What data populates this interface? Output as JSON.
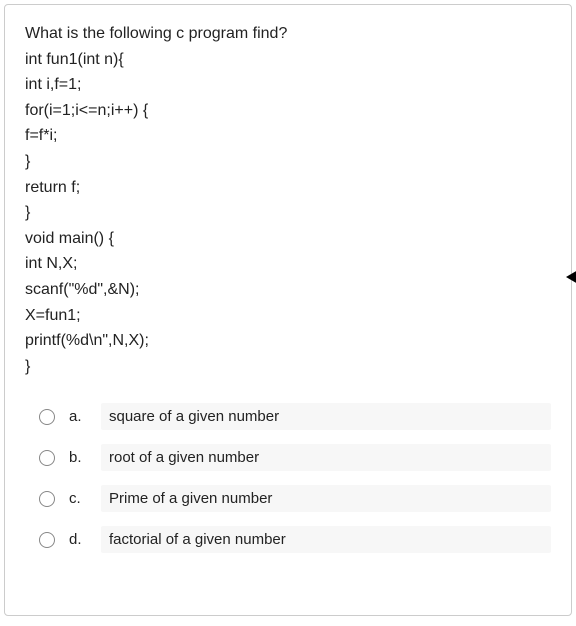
{
  "question": {
    "lines": [
      "What is the following c program find?",
      "int fun1(int n){",
      "int i,f=1;",
      "for(i=1;i<=n;i++) {",
      "f=f*i;",
      "}",
      "return f;",
      "}",
      "void main() {",
      "int N,X;",
      "scanf(\"%d\",&N);",
      "X=fun1;",
      "printf(%d\\n\",N,X);",
      "}"
    ]
  },
  "options": [
    {
      "letter": "a.",
      "text": "square of a given number"
    },
    {
      "letter": "b.",
      "text": "root of a given number"
    },
    {
      "letter": "c.",
      "text": "Prime of a given number"
    },
    {
      "letter": "d.",
      "text": "factorial of a given number"
    }
  ]
}
